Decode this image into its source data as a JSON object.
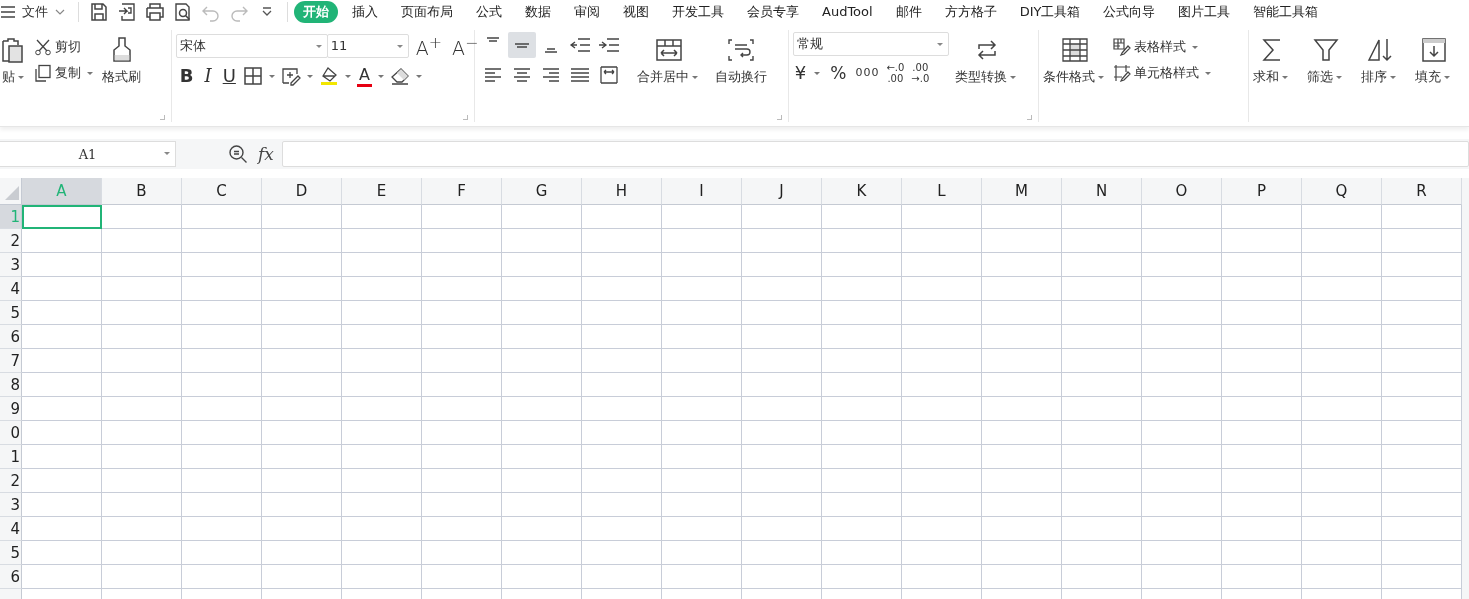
{
  "menu_bar": {
    "file": "文件",
    "tabs": [
      {
        "label": "开始",
        "selected": true
      },
      {
        "label": "插入",
        "selected": false
      },
      {
        "label": "页面布局",
        "selected": false
      },
      {
        "label": "公式",
        "selected": false
      },
      {
        "label": "数据",
        "selected": false
      },
      {
        "label": "审阅",
        "selected": false
      },
      {
        "label": "视图",
        "selected": false
      },
      {
        "label": "开发工具",
        "selected": false
      },
      {
        "label": "会员专享",
        "selected": false
      },
      {
        "label": "AudTool",
        "selected": false
      },
      {
        "label": "邮件",
        "selected": false
      },
      {
        "label": "方方格子",
        "selected": false
      },
      {
        "label": "DIY工具箱",
        "selected": false
      },
      {
        "label": "公式向导",
        "selected": false
      },
      {
        "label": "图片工具",
        "selected": false
      },
      {
        "label": "智能工具箱",
        "selected": false
      }
    ]
  },
  "clipboard": {
    "paste": "贴",
    "cut": "剪切",
    "copy": "复制",
    "format_painter": "格式刷"
  },
  "font": {
    "name": "宋体",
    "size": "11",
    "grow": "A$^{+}$",
    "shrink": "A$^{−}$",
    "bold": "B",
    "italic": "I",
    "underline": "U",
    "font_color": "A"
  },
  "alignment": {
    "vertical": [
      {
        "selected": false
      },
      {
        "selected": true
      },
      {
        "selected": false
      }
    ],
    "merge": "合并居中",
    "wrap": "自动换行"
  },
  "number": {
    "format": "常规",
    "currency": "¥",
    "percent": "%",
    "thousands": "000",
    "increase_decimal": [
      "←.0",
      ".00"
    ],
    "decrease_decimal": [
      ".00",
      "→.0"
    ],
    "convert": "类型转换"
  },
  "styles": {
    "conditional": "条件格式",
    "table_style": "表格样式",
    "cell_style": "单元格样式"
  },
  "editing": [
    "求和",
    "筛选",
    "排序",
    "填充"
  ],
  "formula_bar": {
    "name_box": "A1",
    "fx": "fx"
  },
  "columns": [
    {
      "label": "A",
      "selected": true
    },
    {
      "label": "B",
      "selected": false
    },
    {
      "label": "C",
      "selected": false
    },
    {
      "label": "D",
      "selected": false
    },
    {
      "label": "E",
      "selected": false
    },
    {
      "label": "F",
      "selected": false
    },
    {
      "label": "G",
      "selected": false
    },
    {
      "label": "H",
      "selected": false
    },
    {
      "label": "I",
      "selected": false
    },
    {
      "label": "J",
      "selected": false
    },
    {
      "label": "K",
      "selected": false
    },
    {
      "label": "L",
      "selected": false
    },
    {
      "label": "M",
      "selected": false
    },
    {
      "label": "N",
      "selected": false
    },
    {
      "label": "O",
      "selected": false
    },
    {
      "label": "P",
      "selected": false
    },
    {
      "label": "Q",
      "selected": false
    },
    {
      "label": "R",
      "selected": false
    }
  ],
  "rows": [
    {
      "label": "1",
      "selected": true
    },
    {
      "label": "2",
      "selected": false
    },
    {
      "label": "3",
      "selected": false
    },
    {
      "label": "4",
      "selected": false
    },
    {
      "label": "5",
      "selected": false
    },
    {
      "label": "6",
      "selected": false
    },
    {
      "label": "7",
      "selected": false
    },
    {
      "label": "8",
      "selected": false
    },
    {
      "label": "9",
      "selected": false
    },
    {
      "label": "0",
      "selected": false
    },
    {
      "label": "1",
      "selected": false
    },
    {
      "label": "2",
      "selected": false
    },
    {
      "label": "3",
      "selected": false
    },
    {
      "label": "4",
      "selected": false
    },
    {
      "label": "5",
      "selected": false
    },
    {
      "label": "6",
      "selected": false
    }
  ]
}
